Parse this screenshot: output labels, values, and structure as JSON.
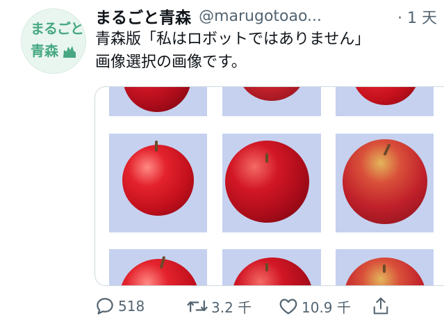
{
  "tweet": {
    "display_name": "まるごと青森",
    "handle": "@marugotoao...",
    "time": "· 1 天",
    "text_line1": "青森版「私はロボットではありません」",
    "text_line2": "画像選択の画像です。"
  },
  "avatar": {
    "line1": "まるごと",
    "line2": "青森",
    "color": "#47a883"
  },
  "actions": {
    "reply_count": "518",
    "retweet_count": "3.2 千",
    "like_count": "10.9 千"
  },
  "icons": {
    "reply": "comment-icon",
    "retweet": "retweet-icon",
    "like": "heart-icon",
    "share": "share-icon"
  },
  "colors": {
    "text": "#0f1419",
    "secondary": "#536471",
    "grid_background": "#c5d1ef",
    "apple_red": "#c3101c"
  }
}
